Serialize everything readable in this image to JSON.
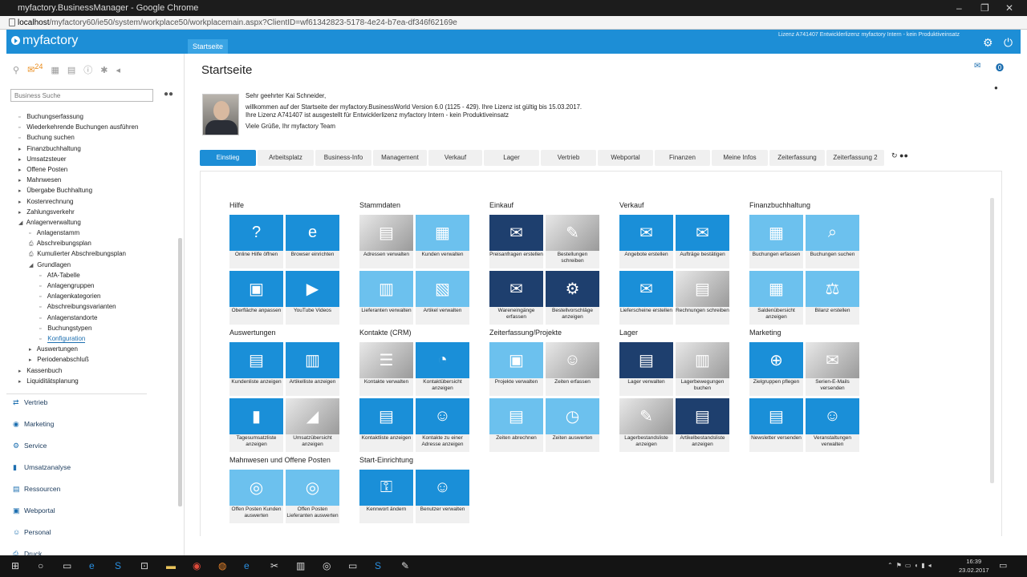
{
  "browser": {
    "title": "myfactory.BusinessManager - Google Chrome",
    "url_host": "localhost",
    "url_path": "/myfactory60/ie50/system/workplace50/workplacemain.aspx?ClientID=wf61342823-5178-4e24-b7ea-df346f62169e"
  },
  "app": {
    "logo": "myfactory",
    "start_tab": "Startseite",
    "license": "Lizenz A741407 Entwicklerlizenz myfactory Intern - kein Produktiveinsatz"
  },
  "sidebar": {
    "badge": "24",
    "search_placeholder": "Business Suche",
    "tree": [
      {
        "label": "Buchungserfassung",
        "indent": 1,
        "icon": "doc"
      },
      {
        "label": "Wiederkehrende Buchungen ausführen",
        "indent": 1,
        "icon": "doc"
      },
      {
        "label": "Buchung suchen",
        "indent": 1,
        "icon": "doc"
      },
      {
        "label": "Finanzbuchhaltung",
        "indent": 1,
        "icon": "caret"
      },
      {
        "label": "Umsatzsteuer",
        "indent": 1,
        "icon": "caret"
      },
      {
        "label": "Offene Posten",
        "indent": 1,
        "icon": "caret"
      },
      {
        "label": "Mahnwesen",
        "indent": 1,
        "icon": "caret"
      },
      {
        "label": "Übergabe Buchhaltung",
        "indent": 1,
        "icon": "caret"
      },
      {
        "label": "Kostenrechnung",
        "indent": 1,
        "icon": "caret"
      },
      {
        "label": "Zahlungsverkehr",
        "indent": 1,
        "icon": "caret"
      },
      {
        "label": "Anlagenverwaltung",
        "indent": 1,
        "icon": "open"
      },
      {
        "label": "Anlagenstamm",
        "indent": 2,
        "icon": "doc"
      },
      {
        "label": "Abschreibungsplan",
        "indent": 2,
        "icon": "print"
      },
      {
        "label": "Kumulierter Abschreibungsplan",
        "indent": 2,
        "icon": "print"
      },
      {
        "label": "Grundlagen",
        "indent": 2,
        "icon": "open"
      },
      {
        "label": "AfA-Tabelle",
        "indent": 3,
        "icon": "doc"
      },
      {
        "label": "Anlagengruppen",
        "indent": 3,
        "icon": "doc"
      },
      {
        "label": "Anlagenkategorien",
        "indent": 3,
        "icon": "doc"
      },
      {
        "label": "Abschreibungsvarianten",
        "indent": 3,
        "icon": "doc"
      },
      {
        "label": "Anlagenstandorte",
        "indent": 3,
        "icon": "doc"
      },
      {
        "label": "Buchungstypen",
        "indent": 3,
        "icon": "doc"
      },
      {
        "label": "Konfiguration",
        "indent": 3,
        "icon": "doc",
        "selected": true
      },
      {
        "label": "Auswertungen",
        "indent": 2,
        "icon": "caret"
      },
      {
        "label": "Periodenabschluß",
        "indent": 2,
        "icon": "caret"
      },
      {
        "label": "Kassenbuch",
        "indent": 1,
        "icon": "caret"
      },
      {
        "label": "Liquiditätsplanung",
        "indent": 1,
        "icon": "caret"
      }
    ],
    "modules": [
      "Vertrieb",
      "Marketing",
      "Service",
      "Umsatzanalyse",
      "Ressourcen",
      "Webportal",
      "Personal",
      "Druck"
    ]
  },
  "main": {
    "title": "Startseite",
    "greeting": "Sehr geehrter Kai Schneider,",
    "welcome_line1": "willkommen auf der Startseite der myfactory.BusinessWorld Version 6.0 (1125 - 429). Ihre Lizenz ist gültig bis 15.03.2017.",
    "welcome_line2": "Ihre Lizenz A741407 ist ausgestellt für Entwicklerlizenz myfactory Intern - kein Produktiveinsatz",
    "signoff": "Viele Grüße, Ihr myfactory Team",
    "tabs": [
      "Einstieg",
      "Arbeitsplatz",
      "Business-Info",
      "Management",
      "Verkauf",
      "Lager",
      "Vertrieb",
      "Webportal",
      "Finanzen",
      "Meine Infos",
      "Zeiterfassung",
      "Zeiterfassung 2"
    ],
    "sections": [
      {
        "title": "Hilfe",
        "tiles": [
          {
            "label": "Online Hilfe öffnen",
            "style": "c1",
            "icon": "?"
          },
          {
            "label": "Browser einrichten",
            "style": "c1",
            "icon": "e"
          },
          {
            "label": "Oberfläche anpassen",
            "style": "c1",
            "icon": "▣"
          },
          {
            "label": "YouTube Videos",
            "style": "c1",
            "icon": "▶"
          }
        ]
      },
      {
        "title": "Stammdaten",
        "tiles": [
          {
            "label": "Adressen verwalten",
            "style": "cp",
            "icon": "▤"
          },
          {
            "label": "Kunden verwalten",
            "style": "c2",
            "icon": "▦"
          },
          {
            "label": "Lieferanten verwalten",
            "style": "c2",
            "icon": "▥"
          },
          {
            "label": "Artikel verwalten",
            "style": "c2",
            "icon": "▧"
          }
        ]
      },
      {
        "title": "Einkauf",
        "tiles": [
          {
            "label": "Preisanfragen erstellen",
            "style": "c3",
            "icon": "✉"
          },
          {
            "label": "Bestellungen schreiben",
            "style": "cp",
            "icon": "✎"
          },
          {
            "label": "Wareneingänge erfassen",
            "style": "c3",
            "icon": "✉"
          },
          {
            "label": "Bestellvorschläge anzeigen",
            "style": "c3",
            "icon": "⚙"
          }
        ]
      },
      {
        "title": "Verkauf",
        "tiles": [
          {
            "label": "Angebote erstellen",
            "style": "c1",
            "icon": "✉"
          },
          {
            "label": "Aufträge bestätigen",
            "style": "c1",
            "icon": "✉"
          },
          {
            "label": "Lieferscheine erstellen",
            "style": "c1",
            "icon": "✉"
          },
          {
            "label": "Rechnungen schreiben",
            "style": "cp",
            "icon": "▤"
          }
        ]
      },
      {
        "title": "Finanzbuchhaltung",
        "tiles": [
          {
            "label": "Buchungen erfassen",
            "style": "c2",
            "icon": "▦"
          },
          {
            "label": "Buchungen suchen",
            "style": "c2",
            "icon": "⌕"
          },
          {
            "label": "Saldenübersicht anzeigen",
            "style": "c2",
            "icon": "▦"
          },
          {
            "label": "Bilanz erstellen",
            "style": "c2",
            "icon": "⚖"
          }
        ]
      },
      {
        "title": "Auswertungen",
        "tiles": [
          {
            "label": "Kundenliste anzeigen",
            "style": "c1",
            "icon": "▤"
          },
          {
            "label": "Artikelliste anzeigen",
            "style": "c1",
            "icon": "▥"
          },
          {
            "label": "Tagesumsatzliste anzeigen",
            "style": "c1",
            "icon": "▮"
          },
          {
            "label": "Umsatzübersicht anzeigen",
            "style": "cp",
            "icon": "◢"
          }
        ]
      },
      {
        "title": "Kontakte (CRM)",
        "tiles": [
          {
            "label": "Kontakte verwalten",
            "style": "cp",
            "icon": "☰"
          },
          {
            "label": "Kontaktübersicht anzeigen",
            "style": "c1",
            "icon": "◔"
          },
          {
            "label": "Kontaktliste anzeigen",
            "style": "c1",
            "icon": "▤"
          },
          {
            "label": "Kontakte zu einer Adresse anzeigen",
            "style": "c1",
            "icon": "☺"
          }
        ]
      },
      {
        "title": "Zeiterfassung/Projekte",
        "tiles": [
          {
            "label": "Projekte verwalten",
            "style": "c2",
            "icon": "▣"
          },
          {
            "label": "Zeiten erfassen",
            "style": "cp",
            "icon": "☺"
          },
          {
            "label": "Zeiten abrechnen",
            "style": "c2",
            "icon": "▤"
          },
          {
            "label": "Zeiten auswerten",
            "style": "c2",
            "icon": "◷"
          }
        ]
      },
      {
        "title": "Lager",
        "tiles": [
          {
            "label": "Lager verwalten",
            "style": "c3",
            "icon": "▤"
          },
          {
            "label": "Lagerbewegungen buchen",
            "style": "cp",
            "icon": "▥"
          },
          {
            "label": "Lagerbestandsliste anzeigen",
            "style": "cp",
            "icon": "✎"
          },
          {
            "label": "Artikelbestandsliste anzeigen",
            "style": "c3",
            "icon": "▤"
          }
        ]
      },
      {
        "title": "Marketing",
        "tiles": [
          {
            "label": "Zielgruppen pflegen",
            "style": "c1",
            "icon": "⊕"
          },
          {
            "label": "Serien-E-Mails versenden",
            "style": "cp",
            "icon": "✉"
          },
          {
            "label": "Newsletter versenden",
            "style": "c1",
            "icon": "▤"
          },
          {
            "label": "Veranstaltungen verwalten",
            "style": "c1",
            "icon": "☺"
          }
        ]
      },
      {
        "title": "Mahnwesen und Offene Posten",
        "tiles": [
          {
            "label": "Offen Posten Kunden auswerten",
            "style": "c2",
            "icon": "◎"
          },
          {
            "label": "Offen Posten Lieferanten auswerten",
            "style": "c2",
            "icon": "◎"
          }
        ]
      },
      {
        "title": "Start-Einrichtung",
        "tiles": [
          {
            "label": "Kennwort ändern",
            "style": "c1",
            "icon": "⚿"
          },
          {
            "label": "Benutzer verwalten",
            "style": "c1",
            "icon": "☺"
          }
        ]
      }
    ]
  },
  "taskbar": {
    "time": "16:39",
    "date": "23.02.2017"
  }
}
